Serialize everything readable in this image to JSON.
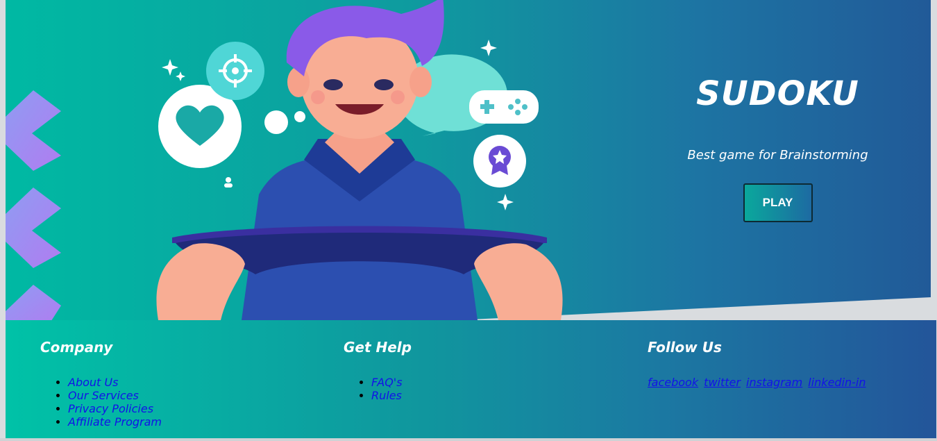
{
  "hero": {
    "title": "SUDOKU",
    "subtitle": "Best game for Brainstorming",
    "play_label": "PLAY"
  },
  "footer": {
    "company": {
      "heading": "Company",
      "links": [
        "About Us",
        "Our Services",
        "Privacy Policies",
        "Affiliate Program"
      ]
    },
    "help": {
      "heading": "Get Help",
      "links": [
        "FAQ's",
        "Rules"
      ]
    },
    "follow": {
      "heading": "Follow Us",
      "links": [
        "facebook",
        "twitter",
        "instagram",
        "linkedin-in"
      ]
    }
  },
  "colors": {
    "hero_start": "#00b9a3",
    "hero_end": "#215a98",
    "link": "#1212e8",
    "chevron": "#a88cf0"
  },
  "icons": [
    "heart-icon",
    "target-icon",
    "gamepad-icon",
    "badge-icon",
    "sparkle-icon",
    "user-icon"
  ]
}
